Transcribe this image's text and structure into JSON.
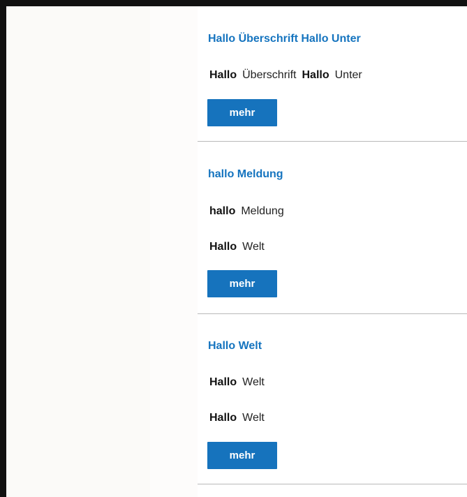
{
  "items": [
    {
      "title": "Hallo Überschrift Hallo Unter",
      "lines": [
        {
          "parts": [
            {
              "label": "Hallo",
              "value": "Überschrift"
            },
            {
              "label": "Hallo",
              "value": "Unter"
            }
          ]
        }
      ],
      "button": "mehr"
    },
    {
      "title": "hallo Meldung",
      "lines": [
        {
          "parts": [
            {
              "label": "hallo",
              "value": "Meldung"
            }
          ]
        },
        {
          "parts": [
            {
              "label": "Hallo",
              "value": "Welt"
            }
          ]
        }
      ],
      "button": "mehr"
    },
    {
      "title": "Hallo Welt",
      "lines": [
        {
          "parts": [
            {
              "label": "Hallo",
              "value": "Welt"
            }
          ]
        },
        {
          "parts": [
            {
              "label": "Hallo",
              "value": "Welt"
            }
          ]
        }
      ],
      "button": "mehr"
    }
  ],
  "colors": {
    "accent": "#1574bf",
    "button_bg": "#1673bd",
    "divider": "#b9b9b9",
    "frame": "#111111"
  }
}
